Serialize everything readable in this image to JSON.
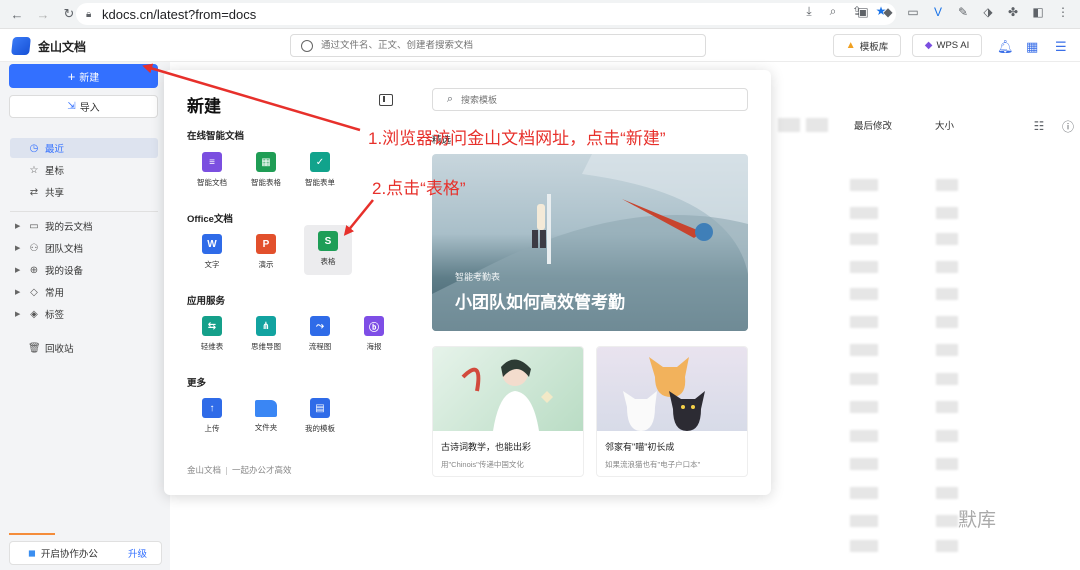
{
  "browser": {
    "url": "kdocs.cn/latest?from=docs"
  },
  "app": {
    "brand": "金山文档",
    "search_placeholder": "通过文件名、正文、创建者搜索文档",
    "template_button": "模板库",
    "ai_button": "WPS AI"
  },
  "sidebar": {
    "new_label": "新建",
    "import_label": "导入",
    "items": [
      {
        "label": "最近",
        "icon": "clock-icon",
        "active": true
      },
      {
        "label": "星标",
        "icon": "star-icon"
      },
      {
        "label": "共享",
        "icon": "share-icon"
      },
      {
        "label": "我的云文档",
        "icon": "folder-icon",
        "expandable": true
      },
      {
        "label": "团队文档",
        "icon": "team-icon",
        "expandable": true
      },
      {
        "label": "我的设备",
        "icon": "device-icon",
        "expandable": true
      },
      {
        "label": "常用",
        "icon": "diamond-icon",
        "expandable": true
      },
      {
        "label": "标签",
        "icon": "tag-icon",
        "expandable": true
      },
      {
        "label": "回收站",
        "icon": "trash-icon"
      }
    ],
    "collab_label": "开启协作办公",
    "upgrade_label": "升级"
  },
  "main": {
    "col_modified": "最后修改",
    "col_size": "大小"
  },
  "popup": {
    "title": "新建",
    "sections": [
      {
        "title": "在线智能文档",
        "items": [
          {
            "label": "智能文档",
            "color": "#7b4fe0",
            "glyph": "≡"
          },
          {
            "label": "智能表格",
            "color": "#1f9d55",
            "glyph": "▦"
          },
          {
            "label": "智能表单",
            "color": "#11a38c",
            "glyph": "✓"
          }
        ]
      },
      {
        "title": "Office文档",
        "items": [
          {
            "label": "文字",
            "color": "#2f6be8",
            "glyph": "W"
          },
          {
            "label": "演示",
            "color": "#e2502c",
            "glyph": "P"
          },
          {
            "label": "表格",
            "color": "#1e9e57",
            "glyph": "S",
            "selected": true
          }
        ]
      },
      {
        "title": "应用服务",
        "items": [
          {
            "label": "轻维表",
            "color": "#15a08a",
            "glyph": "⇆"
          },
          {
            "label": "思维导图",
            "color": "#12a3a0",
            "glyph": "⋔"
          },
          {
            "label": "流程图",
            "color": "#2f6be8",
            "glyph": "⤳"
          },
          {
            "label": "海报",
            "color": "#7e4ee6",
            "glyph": "ⓑ"
          }
        ]
      },
      {
        "title": "更多",
        "items": [
          {
            "label": "上传",
            "color": "#2f6be8",
            "glyph": "↑"
          },
          {
            "label": "文件夹",
            "color": "#3a86f4",
            "glyph": ""
          },
          {
            "label": "我的模板",
            "color": "#2f6be8",
            "glyph": "▤"
          }
        ]
      }
    ],
    "footer_brand": "金山文档",
    "footer_slogan": "一起办公才高效",
    "template_search_placeholder": "搜索模板",
    "template_tab": "精选",
    "banner_sub": "智能考勤表",
    "banner_title": "小团队如何高效管考勤",
    "cards": [
      {
        "title": "古诗词教学，也能出彩",
        "subtitle": "用\"Chinois\"传递中国文化"
      },
      {
        "title": "邻家有\"喵\"初长成",
        "subtitle": "如果流浪猫也有\"电子户口本\""
      }
    ]
  },
  "annotations": {
    "step1": "1.浏览器访问金山文档网址，点击“新建”",
    "step2": "2.点击“表格”",
    "color": "#e7302b"
  },
  "watermark": "默库"
}
